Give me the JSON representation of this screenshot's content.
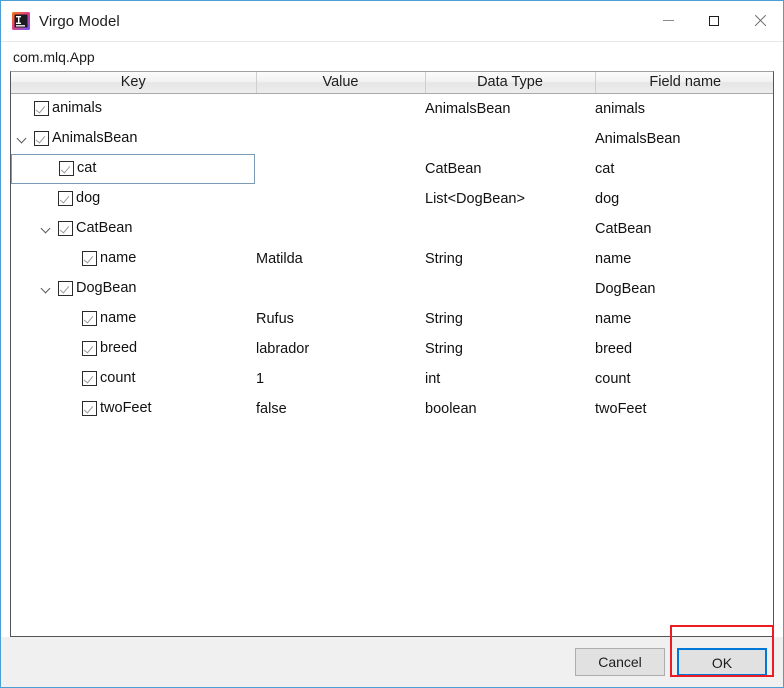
{
  "window": {
    "title": "Virgo Model",
    "app_icon": "intellij-plugin-icon",
    "controls": {
      "minimize": "minimize-icon",
      "maximize": "maximize-icon",
      "close": "close-icon"
    },
    "accent_border": "#4b9fd5"
  },
  "subheader": {
    "class_path": "com.mlq.App"
  },
  "table": {
    "columns": [
      "Key",
      "Value",
      "Data Type",
      "Field name"
    ],
    "rows": [
      {
        "key": "animals",
        "indent": 1,
        "twisty": "none",
        "checked": true,
        "selected": false,
        "value": "",
        "data_type": "AnimalsBean",
        "field_name": "animals"
      },
      {
        "key": "AnimalsBean",
        "indent": 1,
        "twisty": "expanded",
        "checked": true,
        "selected": false,
        "value": "",
        "data_type": "",
        "field_name": "AnimalsBean"
      },
      {
        "key": "cat",
        "indent": 2,
        "twisty": "none",
        "checked": true,
        "selected": true,
        "value": "",
        "data_type": "CatBean",
        "field_name": "cat"
      },
      {
        "key": "dog",
        "indent": 2,
        "twisty": "none",
        "checked": true,
        "selected": false,
        "value": "",
        "data_type": "List<DogBean>",
        "field_name": "dog"
      },
      {
        "key": "CatBean",
        "indent": 2,
        "twisty": "expanded",
        "checked": true,
        "selected": false,
        "value": "",
        "data_type": "",
        "field_name": "CatBean"
      },
      {
        "key": "name",
        "indent": 3,
        "twisty": "none",
        "checked": true,
        "selected": false,
        "value": "Matilda",
        "data_type": "String",
        "field_name": "name"
      },
      {
        "key": "DogBean",
        "indent": 2,
        "twisty": "expanded",
        "checked": true,
        "selected": false,
        "value": "",
        "data_type": "",
        "field_name": "DogBean"
      },
      {
        "key": "name",
        "indent": 3,
        "twisty": "none",
        "checked": true,
        "selected": false,
        "value": "Rufus",
        "data_type": "String",
        "field_name": "name"
      },
      {
        "key": "breed",
        "indent": 3,
        "twisty": "none",
        "checked": true,
        "selected": false,
        "value": "labrador",
        "data_type": "String",
        "field_name": "breed"
      },
      {
        "key": "count",
        "indent": 3,
        "twisty": "none",
        "checked": true,
        "selected": false,
        "value": "1",
        "data_type": "int",
        "field_name": "count"
      },
      {
        "key": "twoFeet",
        "indent": 3,
        "twisty": "none",
        "checked": true,
        "selected": false,
        "value": "false",
        "data_type": "boolean",
        "field_name": "twoFeet"
      }
    ]
  },
  "footer": {
    "cancel_label": "Cancel",
    "ok_label": "OK",
    "ok_is_default": true,
    "annotation_color": "#ec1c24",
    "focus_color": "#0078d7"
  }
}
